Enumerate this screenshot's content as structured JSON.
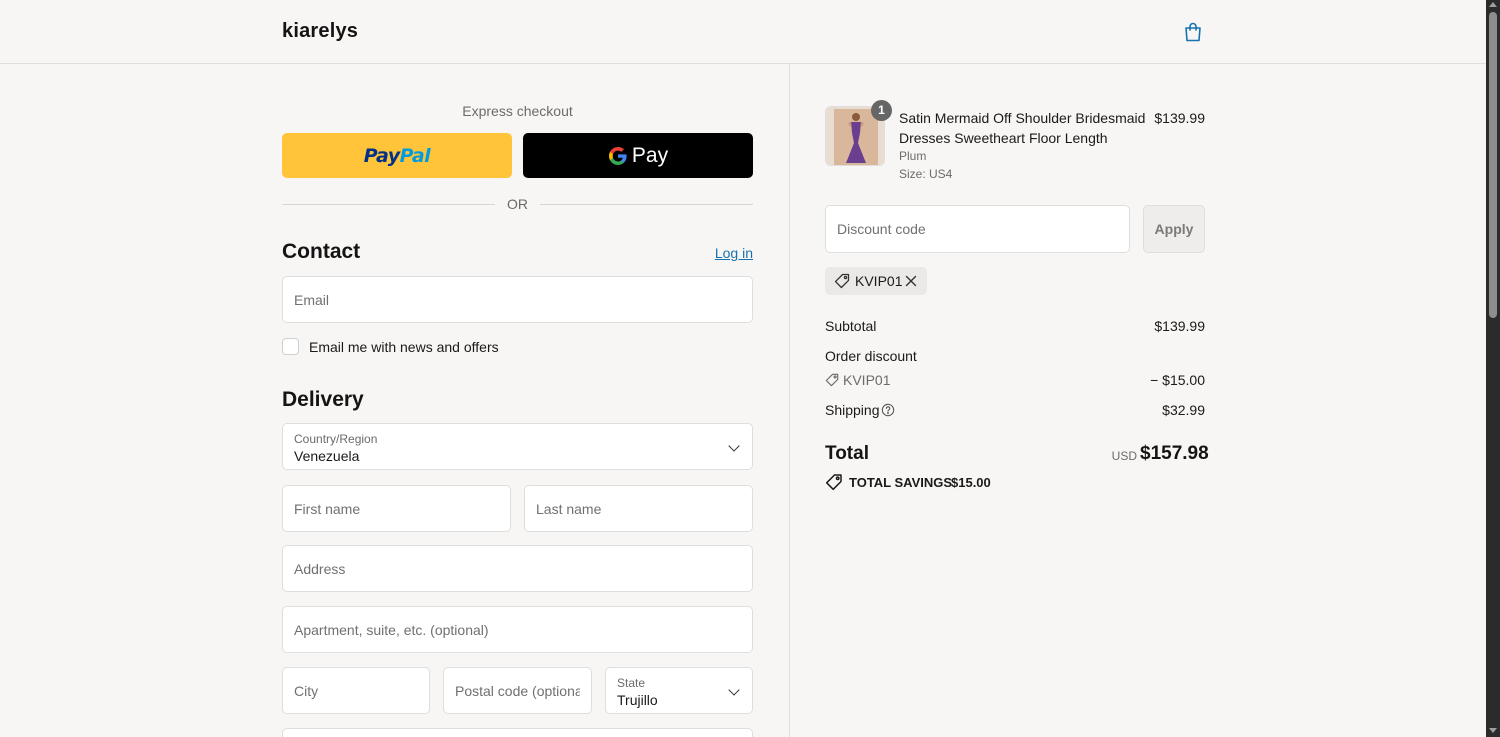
{
  "header": {
    "brand": "kiarelys",
    "cart_icon": "shopping-bag-icon",
    "accent_color": "#1773b0"
  },
  "express": {
    "title": "Express checkout",
    "paypal_part1": "Pay",
    "paypal_part2": "Pal",
    "gpay_label": "Pay",
    "or_text": "OR"
  },
  "contact": {
    "heading": "Contact",
    "login_label": "Log in",
    "email_placeholder": "Email",
    "newsletter_label": "Email me with news and offers"
  },
  "delivery": {
    "heading": "Delivery",
    "country_label": "Country/Region",
    "country_value": "Venezuela",
    "first_name_placeholder": "First name",
    "last_name_placeholder": "Last name",
    "address_placeholder": "Address",
    "apartment_placeholder": "Apartment, suite, etc. (optional)",
    "city_placeholder": "City",
    "postal_placeholder": "Postal code (optional)",
    "state_label": "State",
    "state_value": "Trujillo"
  },
  "cart": {
    "item": {
      "quantity": "1",
      "title": "Satin Mermaid Off Shoulder Bridesmaid Dresses Sweetheart Floor Length",
      "variant": "Plum",
      "size": "Size: US4",
      "price": "$139.99"
    },
    "discount_placeholder": "Discount code",
    "apply_label": "Apply",
    "applied_code": "KVIP01",
    "subtotal_label": "Subtotal",
    "subtotal_value": "$139.99",
    "order_discount_label": "Order discount",
    "order_discount_code": "KVIP01",
    "order_discount_value": "− $15.00",
    "shipping_label": "Shipping",
    "shipping_value": "$32.99",
    "total_label": "Total",
    "total_currency": "USD",
    "total_value": "$157.98",
    "savings_label": "TOTAL SAVINGS",
    "savings_value": "$15.00"
  }
}
